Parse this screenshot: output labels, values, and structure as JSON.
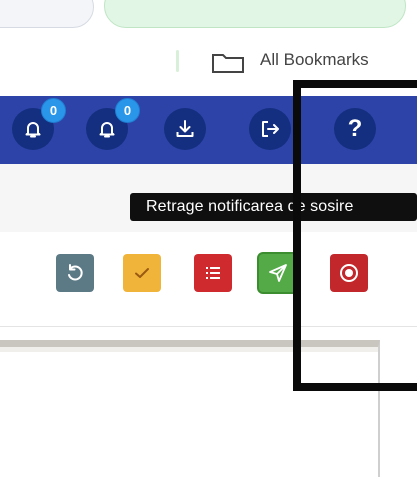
{
  "browser": {
    "bookmarks_label": "All Bookmarks",
    "folder_icon": "folder-icon"
  },
  "toolbar": {
    "notification_badges": [
      "0",
      "0"
    ],
    "help_label": "?",
    "icons": [
      "bell-icon",
      "bell-icon",
      "download-icon",
      "logout-icon",
      "help-icon"
    ]
  },
  "tooltip": {
    "text": "Retrage notificarea de sosire"
  },
  "actions": {
    "icons": [
      "undo-icon",
      "check-icon",
      "list-icon",
      "send-icon",
      "record-icon"
    ]
  },
  "colors": {
    "toolbar_bg": "#2e43a8",
    "icon_circle": "#142f7f",
    "badge": "#2a96ea",
    "undo": "#5c7a86",
    "check": "#f0b43b",
    "list": "#cf2a2e",
    "send": "#53aa47",
    "record": "#c2272b"
  }
}
